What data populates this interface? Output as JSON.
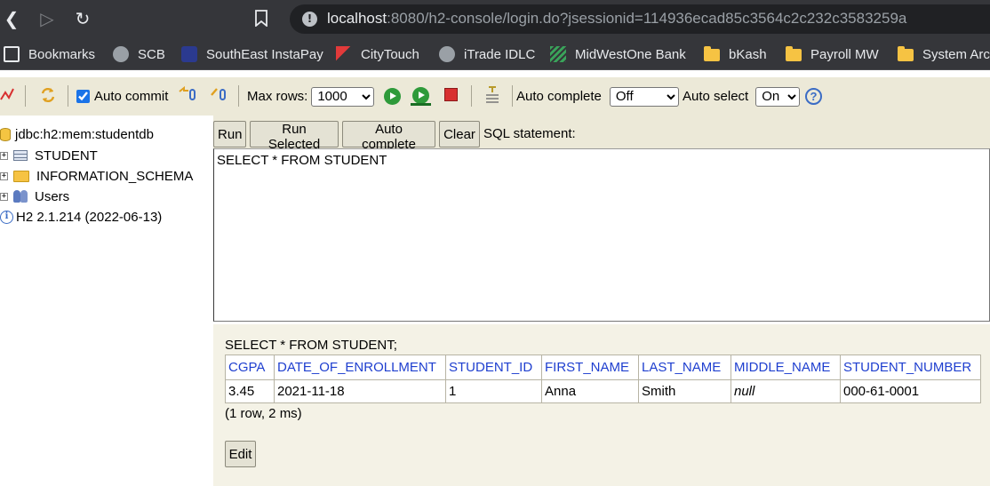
{
  "browser": {
    "url_host": "localhost",
    "url_rest": ":8080/h2-console/login.do?jsessionid=114936ecad85c3564c2c232c3583259a",
    "icons": [
      "back-icon",
      "forward-icon",
      "reload-icon",
      "bookmark-star-icon",
      "site-info-icon"
    ]
  },
  "bookmarks": [
    {
      "label": "Bookmarks",
      "icon": "bookmarks-icon"
    },
    {
      "label": "SCB",
      "icon": "globe-icon"
    },
    {
      "label": "SouthEast InstaPay",
      "icon": "southeast-icon"
    },
    {
      "label": "CityTouch",
      "icon": "citytouch-icon"
    },
    {
      "label": "iTrade IDLC",
      "icon": "globe-icon"
    },
    {
      "label": "MidWestOne Bank",
      "icon": "midwestone-icon"
    },
    {
      "label": "bKash",
      "icon": "folder-icon"
    },
    {
      "label": "Payroll MW",
      "icon": "folder-icon"
    },
    {
      "label": "System Arc",
      "icon": "folder-icon"
    }
  ],
  "toolbar": {
    "auto_commit_label": "Auto commit",
    "auto_commit_checked": true,
    "max_rows_label": "Max rows:",
    "max_rows_value": "1000",
    "auto_complete_label": "Auto complete",
    "auto_complete_value": "Off",
    "auto_select_label": "Auto select",
    "auto_select_value": "On",
    "help_glyph": "?"
  },
  "tree": {
    "connection": "jdbc:h2:mem:studentdb",
    "items": [
      {
        "label": "STUDENT",
        "icon": "table-icon"
      },
      {
        "label": "INFORMATION_SCHEMA",
        "icon": "folder-icon"
      },
      {
        "label": "Users",
        "icon": "users-icon"
      }
    ],
    "version": "H2 2.1.214 (2022-06-13)"
  },
  "query": {
    "run_label": "Run",
    "run_selected_label": "Run Selected",
    "auto_complete_label": "Auto complete",
    "clear_label": "Clear",
    "sql_label": "SQL statement:",
    "sql_text": "SELECT * FROM STUDENT"
  },
  "result": {
    "statement": "SELECT * FROM STUDENT;",
    "columns": [
      "CGPA",
      "DATE_OF_ENROLLMENT",
      "STUDENT_ID",
      "FIRST_NAME",
      "LAST_NAME",
      "MIDDLE_NAME",
      "STUDENT_NUMBER"
    ],
    "rows": [
      [
        "3.45",
        "2021-11-18",
        "1",
        "Anna",
        "Smith",
        "null",
        "000-61-0001"
      ]
    ],
    "summary": "(1 row, 2 ms)",
    "edit_label": "Edit"
  }
}
